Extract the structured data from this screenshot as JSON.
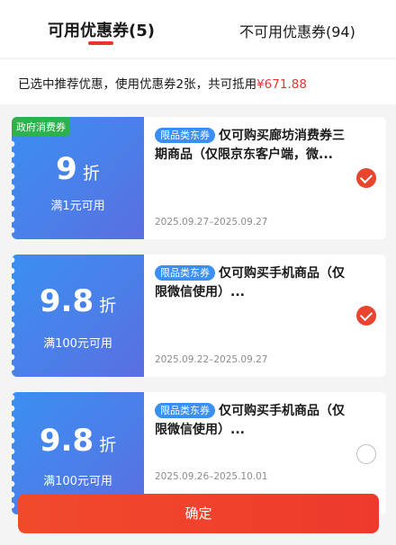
{
  "tabs": {
    "available": "可用优惠券(5)",
    "unavailable": "不可用优惠券(94)"
  },
  "summary": {
    "text": "已选中推荐优惠，使用优惠券2张，共可抵用",
    "amount": "¥671.88"
  },
  "colors": {
    "accent": "#e8362f",
    "gov_tag": "#2bb24c",
    "card_blue": "#4d7de8"
  },
  "coupons": [
    {
      "tag": "政府消费券",
      "discount": "9",
      "unit": "折",
      "condition": "满1元可用",
      "badge": "限品类东券",
      "title": "仅可购买廊坊消费券三期商品（仅限京东客户端，微...",
      "dates": "2025.09.27–2025.09.27",
      "selected": true
    },
    {
      "discount": "9.8",
      "unit": "折",
      "condition": "满100元可用",
      "badge": "限品类东券",
      "title": "仅可购买手机商品（仅限微信使用）...",
      "dates": "2025.09.22–2025.09.27",
      "selected": true
    },
    {
      "discount": "9.8",
      "unit": "折",
      "condition": "满100元可用",
      "badge": "限品类东券",
      "title": "仅可购买手机商品（仅限微信使用）...",
      "dates": "2025.09.26–2025.10.01",
      "selected": false
    }
  ],
  "confirm_label": "确定"
}
